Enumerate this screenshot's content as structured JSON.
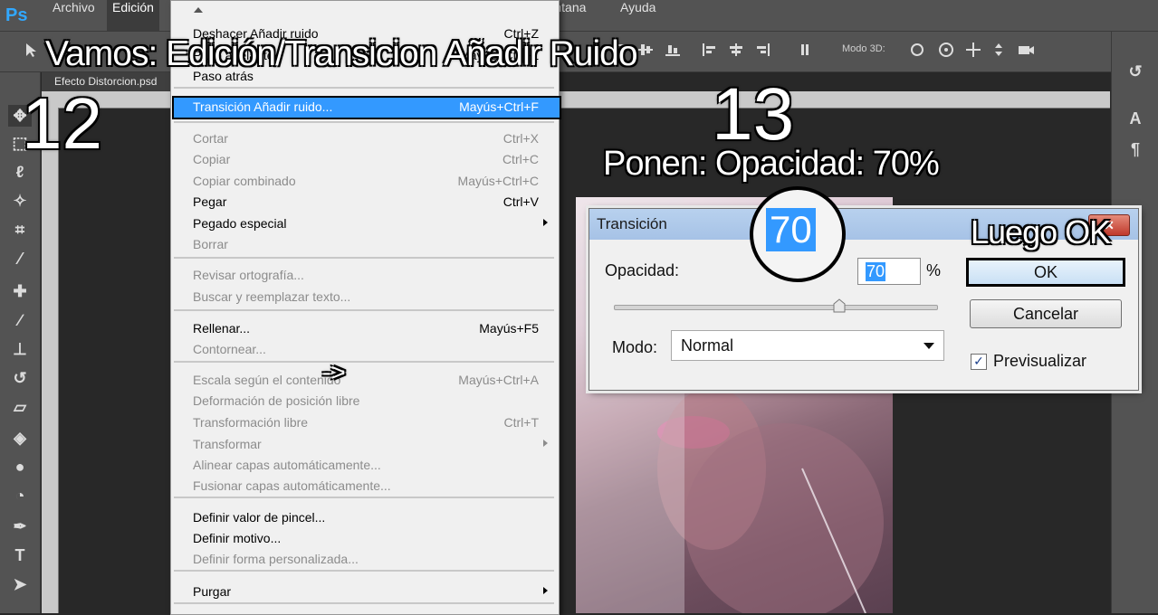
{
  "app": {
    "logo": "Ps"
  },
  "menubar": {
    "items": [
      "Archivo",
      "Edición",
      "Ventana",
      "Ayuda"
    ]
  },
  "options_bar": {
    "mode3d_label": "Modo 3D:"
  },
  "document": {
    "tab_title": "Efecto Distorcion.psd"
  },
  "edit_menu": {
    "items": [
      {
        "label": "Deshacer Añadir ruido",
        "shortcut": "Ctrl+Z",
        "disabled": false
      },
      {
        "label": "Paso adelante",
        "shortcut": "Mayús+Ctrl+Z",
        "disabled": false
      },
      {
        "label": "Paso atrás",
        "shortcut": "",
        "disabled": false
      },
      {
        "label": "Transición Añadir ruido...",
        "shortcut": "Mayús+Ctrl+F",
        "highlighted": true
      },
      {
        "label": "Cortar",
        "shortcut": "Ctrl+X",
        "disabled": true
      },
      {
        "label": "Copiar",
        "shortcut": "Ctrl+C",
        "disabled": true
      },
      {
        "label": "Copiar combinado",
        "shortcut": "Mayús+Ctrl+C",
        "disabled": true
      },
      {
        "label": "Pegar",
        "shortcut": "Ctrl+V",
        "disabled": false
      },
      {
        "label": "Pegado especial",
        "shortcut": "",
        "submenu": true,
        "disabled": false
      },
      {
        "label": "Borrar",
        "shortcut": "",
        "disabled": true
      },
      {
        "label": "Revisar ortografía...",
        "shortcut": "",
        "disabled": true
      },
      {
        "label": "Buscar y reemplazar texto...",
        "shortcut": "",
        "disabled": true
      },
      {
        "label": "Rellenar...",
        "shortcut": "Mayús+F5",
        "disabled": false
      },
      {
        "label": "Contornear...",
        "shortcut": "",
        "disabled": true
      },
      {
        "label": "Escala según el contenido",
        "shortcut": "Mayús+Ctrl+A",
        "disabled": true
      },
      {
        "label": "Deformación de posición libre",
        "shortcut": "",
        "disabled": true
      },
      {
        "label": "Transformación libre",
        "shortcut": "Ctrl+T",
        "disabled": true
      },
      {
        "label": "Transformar",
        "shortcut": "",
        "submenu": true,
        "disabled": true
      },
      {
        "label": "Alinear capas automáticamente...",
        "shortcut": "",
        "disabled": true
      },
      {
        "label": "Fusionar capas automáticamente...",
        "shortcut": "",
        "disabled": true
      },
      {
        "label": "Definir valor de pincel...",
        "shortcut": "",
        "disabled": false
      },
      {
        "label": "Definir motivo...",
        "shortcut": "",
        "disabled": false
      },
      {
        "label": "Definir forma personalizada...",
        "shortcut": "",
        "disabled": true
      },
      {
        "label": "Purgar",
        "shortcut": "",
        "submenu": true,
        "disabled": false
      }
    ]
  },
  "dialog": {
    "title": "Transición",
    "close_label": "✕",
    "opacity_label": "Opacidad:",
    "opacity_value": "70",
    "opacity_unit": "%",
    "opacity_fraction": 0.7,
    "mode_label": "Modo:",
    "mode_value": "Normal",
    "ok_label": "OK",
    "cancel_label": "Cancelar",
    "preview_label": "Previsualizar",
    "preview_checked": true
  },
  "annotations": {
    "step12_text": "Vamos: Edición/Transicion Añadir Ruido",
    "step12_number": "12",
    "step13_number": "13",
    "step13_text": "Ponen: Opacidad: 70%",
    "step_ok_text": "Luego OK",
    "magnifier_value": "70",
    "arrow": "->"
  },
  "colors": {
    "menu_highlight": "#3399ff",
    "ps_blue": "#31a8ff",
    "ui_dark": "#535353"
  },
  "icons": {
    "tools": [
      "move-tool-icon",
      "marquee-tool-icon",
      "lasso-tool-icon",
      "magic-wand-tool-icon",
      "crop-tool-icon",
      "eyedropper-tool-icon",
      "healing-tool-icon",
      "brush-tool-icon",
      "stamp-tool-icon",
      "history-brush-tool-icon",
      "eraser-tool-icon",
      "paint-bucket-tool-icon",
      "blur-tool-icon",
      "dodge-tool-icon",
      "pen-tool-icon",
      "type-tool-icon",
      "path-selection-tool-icon"
    ]
  }
}
